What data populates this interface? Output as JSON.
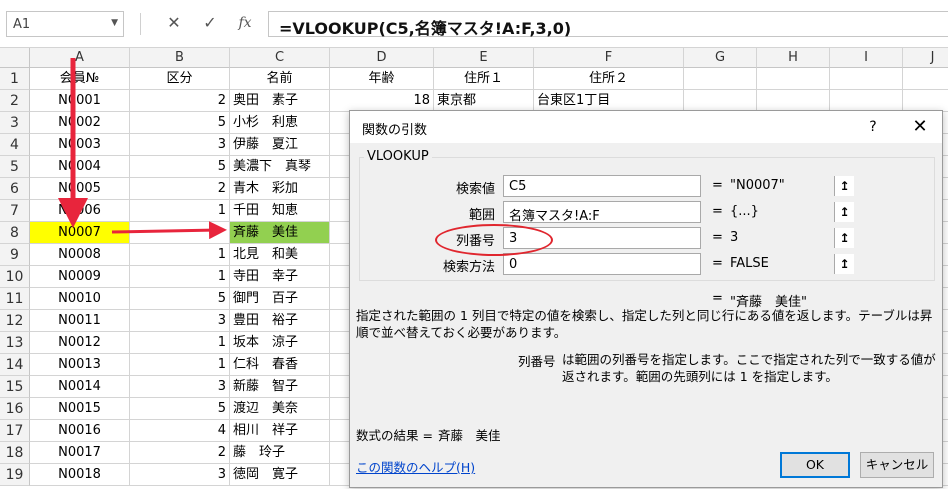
{
  "formula_bar": {
    "name_box": "A1",
    "cancel_icon": "✕",
    "enter_icon": "✓",
    "fx_icon": "fx",
    "formula": "=VLOOKUP(C5,名簿マスタ!A:F,3,0)"
  },
  "columns": [
    "A",
    "B",
    "C",
    "D",
    "E",
    "F",
    "G",
    "H",
    "I",
    "J"
  ],
  "header_row": {
    "a": "会員№",
    "b": "区分",
    "c": "名前",
    "d": "年齢",
    "e": "住所１",
    "f": "住所２"
  },
  "rows": [
    {
      "num": "1"
    },
    {
      "num": "2",
      "a": "N0001",
      "b": "2",
      "c": "奥田　素子",
      "d": "18",
      "e": "東京都",
      "f": "台東区1丁目"
    },
    {
      "num": "3",
      "a": "N0002",
      "b": "5",
      "c": "小杉　利恵"
    },
    {
      "num": "4",
      "a": "N0003",
      "b": "3",
      "c": "伊藤　夏江"
    },
    {
      "num": "5",
      "a": "N0004",
      "b": "5",
      "c": "美濃下　真琴"
    },
    {
      "num": "6",
      "a": "N0005",
      "b": "2",
      "c": "青木　彩加"
    },
    {
      "num": "7",
      "a": "N0006",
      "b": "1",
      "c": "千田　知恵"
    },
    {
      "num": "8",
      "a": "N0007",
      "b": "",
      "c": "斉藤　美佳"
    },
    {
      "num": "9",
      "a": "N0008",
      "b": "1",
      "c": "北見　和美"
    },
    {
      "num": "10",
      "a": "N0009",
      "b": "1",
      "c": "寺田　幸子"
    },
    {
      "num": "11",
      "a": "N0010",
      "b": "5",
      "c": "御門　百子"
    },
    {
      "num": "12",
      "a": "N0011",
      "b": "3",
      "c": "豊田　裕子"
    },
    {
      "num": "13",
      "a": "N0012",
      "b": "1",
      "c": "坂本　涼子"
    },
    {
      "num": "14",
      "a": "N0013",
      "b": "1",
      "c": "仁科　春香"
    },
    {
      "num": "15",
      "a": "N0014",
      "b": "3",
      "c": "新藤　智子"
    },
    {
      "num": "16",
      "a": "N0015",
      "b": "5",
      "c": "渡辺　美奈"
    },
    {
      "num": "17",
      "a": "N0016",
      "b": "4",
      "c": "相川　祥子"
    },
    {
      "num": "18",
      "a": "N0017",
      "b": "2",
      "c": "藤　玲子"
    },
    {
      "num": "19",
      "a": "N0018",
      "b": "3",
      "c": "徳岡　寛子"
    }
  ],
  "dialog": {
    "title": "関数の引数",
    "help_icon": "?",
    "close_icon": "✕",
    "function_name": "VLOOKUP",
    "args": [
      {
        "label": "検索値",
        "value": "C5",
        "result": "\"N0007\""
      },
      {
        "label": "範囲",
        "value": "名簿マスタ!A:F",
        "result": "{...}"
      },
      {
        "label": "列番号",
        "value": "3",
        "result": "3"
      },
      {
        "label": "検索方法",
        "value": "0",
        "result": "FALSE"
      }
    ],
    "eq": "=",
    "ref_icon": "↥",
    "overall_result": "\"斉藤　美佳\"",
    "description": "指定された範囲の 1 列目で特定の値を検索し、指定した列と同じ行にある値を返します。テーブルは昇順で並べ替えておく必要があります。",
    "arg_desc_name": "列番号",
    "arg_desc": "は範囲の列番号を指定します。ここで指定された列で一致する値が返されます。範囲の先頭列には 1 を指定します。",
    "result_label": "数式の結果 =",
    "result_value": "斉藤　美佳",
    "help_link": "この関数のヘルプ(H)",
    "ok": "OK",
    "cancel": "キャンセル"
  },
  "colors": {
    "highlight_yellow": "#ffff00",
    "highlight_green": "#92d050",
    "arrow_red": "#e8253c",
    "oval_red": "#e0262e"
  }
}
